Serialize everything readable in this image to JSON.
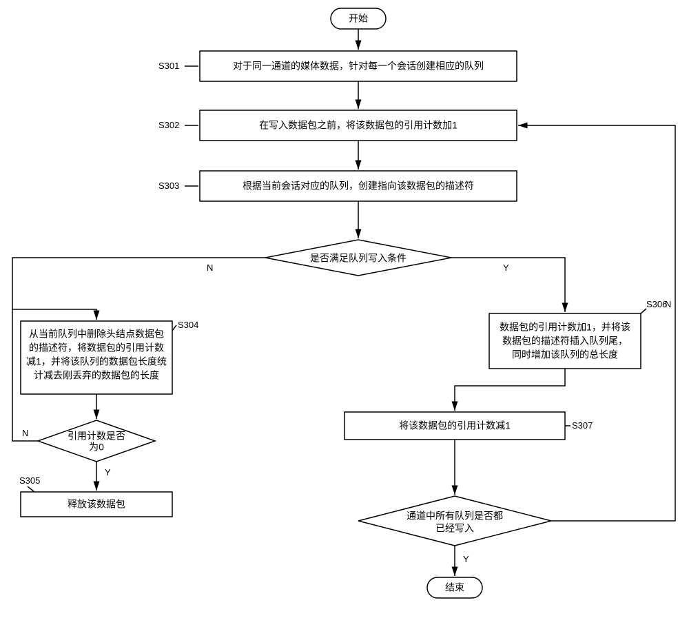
{
  "chart_data": {
    "type": "flowchart",
    "title": "",
    "nodes": [
      {
        "id": "start",
        "type": "terminator",
        "text": "开始"
      },
      {
        "id": "s301",
        "type": "process",
        "label": "S301",
        "text": "对于同一通道的媒体数据，针对每一个会话创建相应的队列"
      },
      {
        "id": "s302",
        "type": "process",
        "label": "S302",
        "text": "在写入数据包之前，将该数据包的引用计数加1"
      },
      {
        "id": "s303",
        "type": "process",
        "label": "S303",
        "text": "根据当前会话对应的队列，创建指向该数据包的描述符"
      },
      {
        "id": "d1",
        "type": "decision",
        "text": "是否满足队列写入条件"
      },
      {
        "id": "s304",
        "type": "process",
        "label": "S304",
        "text": "从当前队列中删除头结点数据包的描述符，将数据包的引用计数减1，并将该队列的数据包长度统计减去刚丢弃的数据包的长度"
      },
      {
        "id": "d2",
        "type": "decision",
        "text": "引用计数是否为0"
      },
      {
        "id": "s305",
        "type": "process",
        "label": "S305",
        "text": "释放该数据包"
      },
      {
        "id": "s306",
        "type": "process",
        "label": "S306",
        "text": "数据包的引用计数加1，并将该数据包的描述符插入队列尾，同时增加该队列的总长度"
      },
      {
        "id": "s307",
        "type": "process",
        "label": "S307",
        "text": "将该数据包的引用计数减1"
      },
      {
        "id": "d3",
        "type": "decision",
        "text": "通道中所有队列是否都已经写入"
      },
      {
        "id": "end",
        "type": "terminator",
        "text": "结束"
      }
    ],
    "edges": [
      {
        "from": "start",
        "to": "s301"
      },
      {
        "from": "s301",
        "to": "s302"
      },
      {
        "from": "s302",
        "to": "s303"
      },
      {
        "from": "s303",
        "to": "d1"
      },
      {
        "from": "d1",
        "to": "s304",
        "label": "N"
      },
      {
        "from": "d1",
        "to": "s306",
        "label": "Y"
      },
      {
        "from": "s304",
        "to": "d2"
      },
      {
        "from": "d2",
        "to": "d1",
        "label": "N"
      },
      {
        "from": "d2",
        "to": "s305",
        "label": "Y"
      },
      {
        "from": "s306",
        "to": "s307"
      },
      {
        "from": "s307",
        "to": "d3"
      },
      {
        "from": "d3",
        "to": "s302",
        "label": "N"
      },
      {
        "from": "d3",
        "to": "end",
        "label": "Y"
      }
    ]
  },
  "labels": {
    "start": "开始",
    "end": "结束",
    "s301_tag": "S301",
    "s302_tag": "S302",
    "s303_tag": "S303",
    "s304_tag": "S304",
    "s305_tag": "S305",
    "s306_tag": "S306",
    "s307_tag": "S307",
    "s301": "对于同一通道的媒体数据，针对每一个会话创建相应的队列",
    "s302": "在写入数据包之前，将该数据包的引用计数加1",
    "s303": "根据当前会话对应的队列，创建指向该数据包的描述符",
    "d1": "是否满足队列写入条件",
    "s304_l1": "从当前队列中删除头结点数据包",
    "s304_l2": "的描述符，将数据包的引用计数",
    "s304_l3": "减1，并将该队列的数据包长度统",
    "s304_l4": "计减去刚丢弃的数据包的长度",
    "d2_l1": "引用计数是否",
    "d2_l2": "为0",
    "s305": "释放该数据包",
    "s306_l1": "数据包的引用计数加1，并将该",
    "s306_l2": "数据包的描述符插入队列尾，",
    "s306_l3": "同时增加该队列的总长度",
    "s307": "将该数据包的引用计数减1",
    "d3_l1": "通道中所有队列是否都",
    "d3_l2": "已经写入",
    "Y": "Y",
    "N": "N"
  }
}
